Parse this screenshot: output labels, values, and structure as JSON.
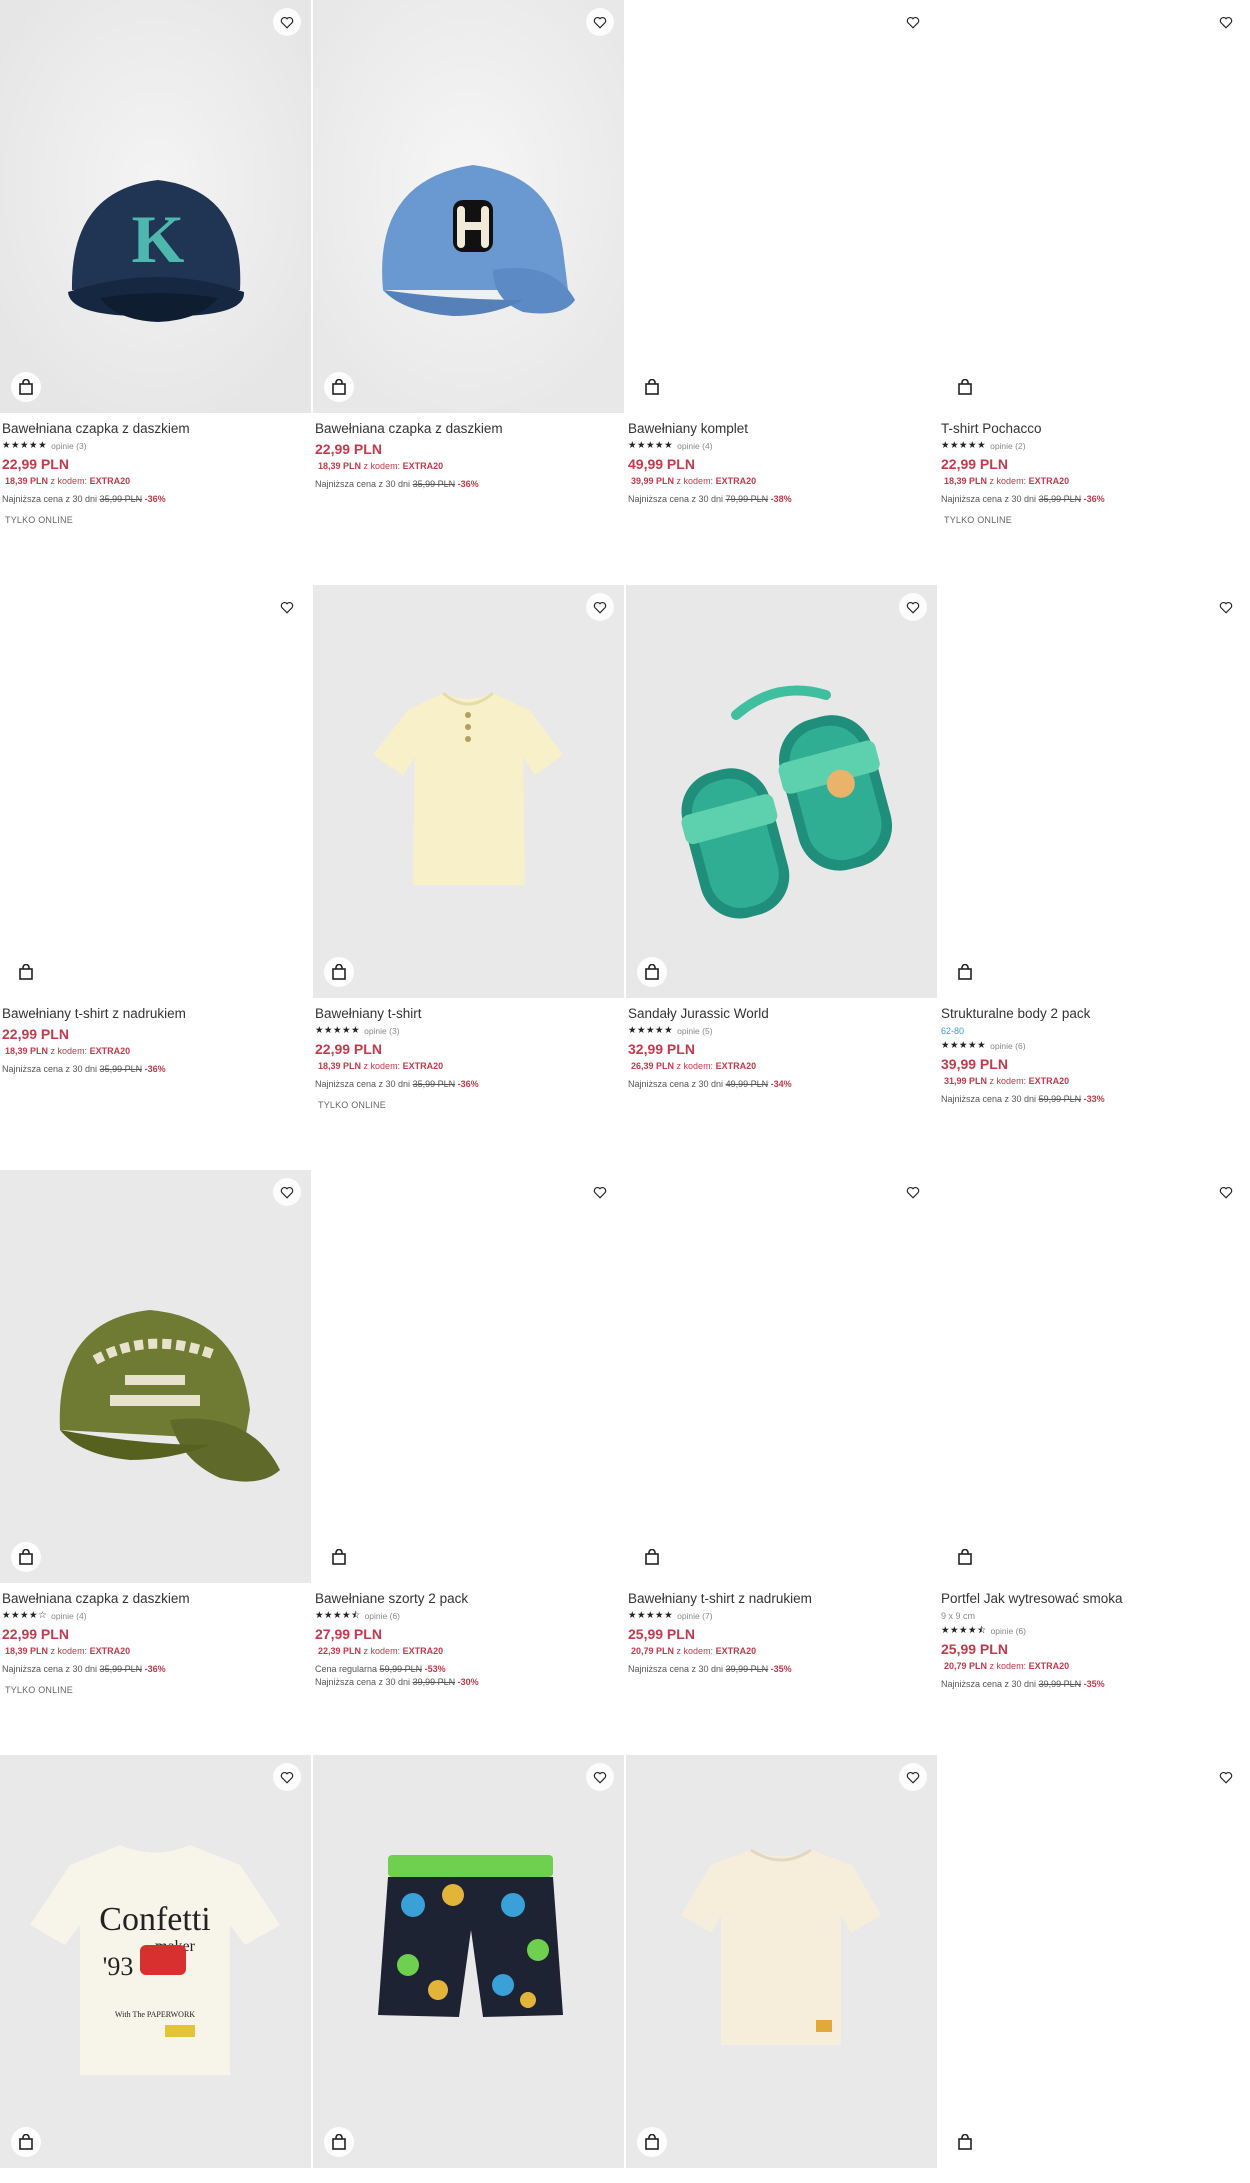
{
  "products": [
    {
      "name": "Bawełniana czapka z daszkiem",
      "stars": "★★★★★",
      "reviews": "opinie (3)",
      "price": "22,99 PLN",
      "promo_price": "18,39 PLN",
      "promo_text": "z kodem:",
      "promo_code": "EXTRA20",
      "lowest_label": "Najniższa cena z 30 dni",
      "lowest_price": "35,99 PLN",
      "lowest_pct": "-36%",
      "badge": "TYLKO ONLINE"
    },
    {
      "name": "Bawełniana czapka z daszkiem",
      "price": "22,99 PLN",
      "promo_price": "18,39 PLN",
      "promo_text": "z kodem:",
      "promo_code": "EXTRA20",
      "lowest_label": "Najniższa cena z 30 dni",
      "lowest_price": "35,99 PLN",
      "lowest_pct": "-36%"
    },
    {
      "name": "Bawełniany komplet",
      "stars": "★★★★★",
      "reviews": "opinie (4)",
      "price": "49,99 PLN",
      "promo_price": "39,99 PLN",
      "promo_text": "z kodem:",
      "promo_code": "EXTRA20",
      "lowest_label": "Najniższa cena z 30 dni",
      "lowest_price": "79,99 PLN",
      "lowest_pct": "-38%"
    },
    {
      "name": "T-shirt Pochacco",
      "stars": "★★★★★",
      "reviews": "opinie (2)",
      "price": "22,99 PLN",
      "promo_price": "18,39 PLN",
      "promo_text": "z kodem:",
      "promo_code": "EXTRA20",
      "lowest_label": "Najniższa cena z 30 dni",
      "lowest_price": "35,99 PLN",
      "lowest_pct": "-36%",
      "badge": "TYLKO ONLINE"
    },
    {
      "name": "Bawełniany t-shirt z nadrukiem",
      "price": "22,99 PLN",
      "promo_price": "18,39 PLN",
      "promo_text": "z kodem:",
      "promo_code": "EXTRA20",
      "lowest_label": "Najniższa cena z 30 dni",
      "lowest_price": "35,99 PLN",
      "lowest_pct": "-36%"
    },
    {
      "name": "Bawełniany t-shirt",
      "stars": "★★★★★",
      "reviews": "opinie (3)",
      "price": "22,99 PLN",
      "promo_price": "18,39 PLN",
      "promo_text": "z kodem:",
      "promo_code": "EXTRA20",
      "lowest_label": "Najniższa cena z 30 dni",
      "lowest_price": "35,99 PLN",
      "lowest_pct": "-36%",
      "badge": "TYLKO ONLINE"
    },
    {
      "name": "Sandały Jurassic World",
      "stars": "★★★★★",
      "reviews": "opinie (5)",
      "price": "32,99 PLN",
      "promo_price": "26,39 PLN",
      "promo_text": "z kodem:",
      "promo_code": "EXTRA20",
      "lowest_label": "Najniższa cena z 30 dni",
      "lowest_price": "49,99 PLN",
      "lowest_pct": "-34%"
    },
    {
      "name": "Strukturalne body 2 pack",
      "size": "62-80",
      "stars": "★★★★★",
      "reviews": "opinie (6)",
      "price": "39,99 PLN",
      "promo_price": "31,99 PLN",
      "promo_text": "z kodem:",
      "promo_code": "EXTRA20",
      "lowest_label": "Najniższa cena z 30 dni",
      "lowest_price": "59,99 PLN",
      "lowest_pct": "-33%"
    },
    {
      "name": "Bawełniana czapka z daszkiem",
      "stars": "★★★★☆",
      "reviews": "opinie (4)",
      "price": "22,99 PLN",
      "promo_price": "18,39 PLN",
      "promo_text": "z kodem:",
      "promo_code": "EXTRA20",
      "lowest_label": "Najniższa cena z 30 dni",
      "lowest_price": "35,99 PLN",
      "lowest_pct": "-36%",
      "badge": "TYLKO ONLINE"
    },
    {
      "name": "Bawełniane szorty 2 pack",
      "stars": "★★★★⯪",
      "reviews": "opinie (6)",
      "price": "27,99 PLN",
      "promo_price": "22,39 PLN",
      "promo_text": "z kodem:",
      "promo_code": "EXTRA20",
      "regular_label": "Cena regularna",
      "regular_price": "59,99 PLN",
      "regular_pct": "-53%",
      "lowest_label": "Najniższa cena z 30 dni",
      "lowest_price": "39,99 PLN",
      "lowest_pct": "-30%"
    },
    {
      "name": "Bawełniany t-shirt z nadrukiem",
      "stars": "★★★★★",
      "reviews": "opinie (7)",
      "price": "25,99 PLN",
      "promo_price": "20,79 PLN",
      "promo_text": "z kodem:",
      "promo_code": "EXTRA20",
      "lowest_label": "Najniższa cena z 30 dni",
      "lowest_price": "39,99 PLN",
      "lowest_pct": "-35%"
    },
    {
      "name": "Portfel Jak wytresować smoka",
      "size": "9 x 9 cm",
      "stars": "★★★★⯪",
      "reviews": "opinie (6)",
      "price": "25,99 PLN",
      "promo_price": "20,79 PLN",
      "promo_text": "z kodem:",
      "promo_code": "EXTRA20",
      "lowest_label": "Najniższa cena z 30 dni",
      "lowest_price": "39,99 PLN",
      "lowest_pct": "-35%"
    },
    {
      "name": "",
      "print_text": {
        "line1": "Confetti",
        "line2": "maker",
        "year": "'93",
        "tagline": "With The PAPERWORK"
      }
    },
    {
      "name": ""
    },
    {
      "name": ""
    },
    {
      "name": ""
    }
  ],
  "colors": {
    "price": "#c23a4b",
    "image_bg": "#ececec",
    "size_link": "#3a9bd0"
  },
  "icons": {
    "wishlist": "heart-icon",
    "cart": "shopping-bag-icon"
  }
}
